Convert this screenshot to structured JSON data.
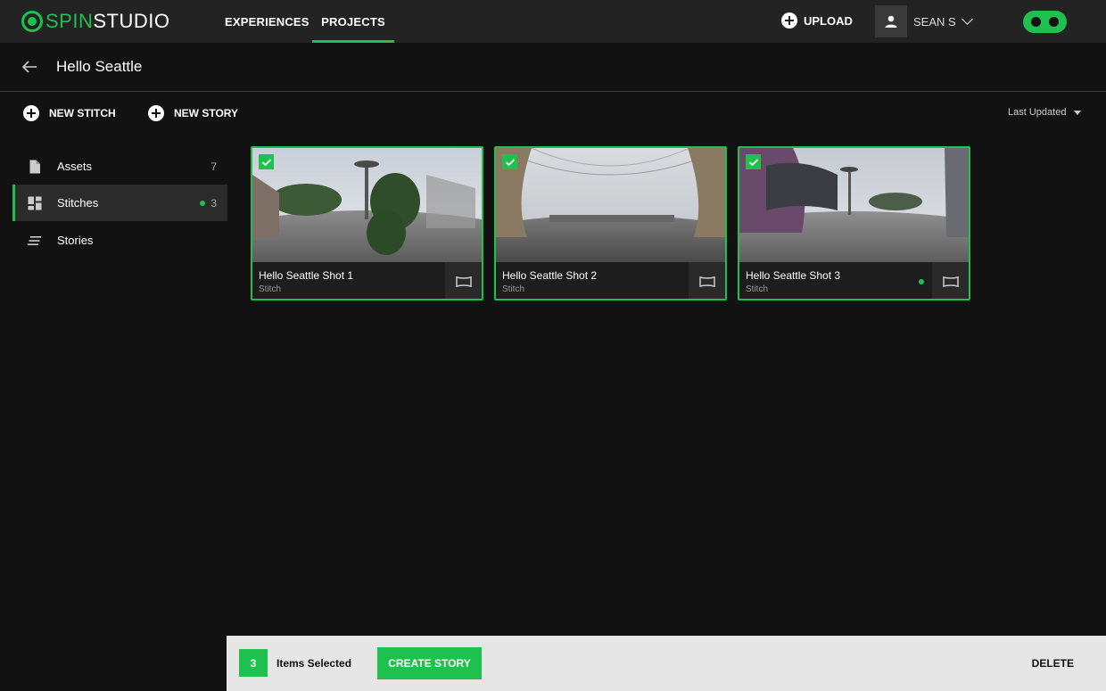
{
  "app": {
    "logo_spin": "SPIN",
    "logo_studio": "STUDIO",
    "accent": "#1fc14e"
  },
  "nav": {
    "tabs": [
      {
        "label": "EXPERIENCES",
        "active": false
      },
      {
        "label": "PROJECTS",
        "active": true
      }
    ],
    "upload_label": "UPLOAD",
    "user_name": "SEAN S"
  },
  "page": {
    "title": "Hello Seattle"
  },
  "actions": {
    "new_stitch": "NEW STITCH",
    "new_story": "NEW STORY",
    "sort_label": "Last Updated"
  },
  "sidebar": {
    "items": [
      {
        "label": "Assets",
        "count": "7",
        "icon": "document-icon",
        "active": false
      },
      {
        "label": "Stitches",
        "count": "3",
        "icon": "dashboard-icon",
        "active": true
      },
      {
        "label": "Stories",
        "count": "",
        "icon": "stories-icon",
        "active": false
      }
    ]
  },
  "cards": [
    {
      "title": "Hello Seattle Shot 1",
      "type": "Stitch",
      "selected": true,
      "status_dot": false
    },
    {
      "title": "Hello Seattle Shot 2",
      "type": "Stitch",
      "selected": true,
      "status_dot": false
    },
    {
      "title": "Hello Seattle Shot 3",
      "type": "Stitch",
      "selected": true,
      "status_dot": true
    }
  ],
  "selection_bar": {
    "count": "3",
    "label": "Items Selected",
    "create_story": "CREATE STORY",
    "delete": "DELETE"
  }
}
